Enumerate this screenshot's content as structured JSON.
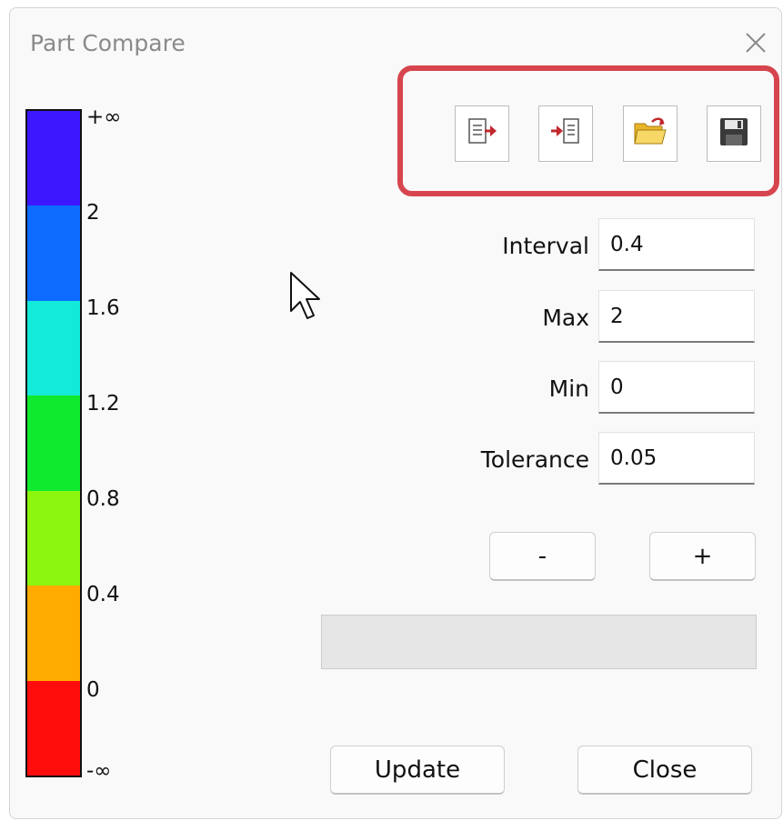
{
  "window": {
    "title": "Part Compare",
    "close_icon": "close-icon"
  },
  "legend": {
    "labels": [
      "+∞",
      "2",
      "1.6",
      "1.2",
      "0.8",
      "0.4",
      "0",
      "-∞"
    ],
    "colors": [
      "#3b16ff",
      "#0d6cff",
      "#14ead8",
      "#10ea2e",
      "#8cf60f",
      "#ffab00",
      "#ff0c0c"
    ]
  },
  "toolbar": {
    "buttons": [
      {
        "icon": "export-icon"
      },
      {
        "icon": "import-icon"
      },
      {
        "icon": "open-folder-icon"
      },
      {
        "icon": "save-icon"
      }
    ],
    "highlight_color": "#d6454e"
  },
  "fields": {
    "interval": {
      "label": "Interval",
      "value": "0.4"
    },
    "max": {
      "label": "Max",
      "value": "2"
    },
    "min": {
      "label": "Min",
      "value": "0"
    },
    "tolerance": {
      "label": "Tolerance",
      "value": "0.05"
    }
  },
  "steppers": {
    "minus": "-",
    "plus": "+"
  },
  "actions": {
    "update": "Update",
    "close": "Close"
  }
}
